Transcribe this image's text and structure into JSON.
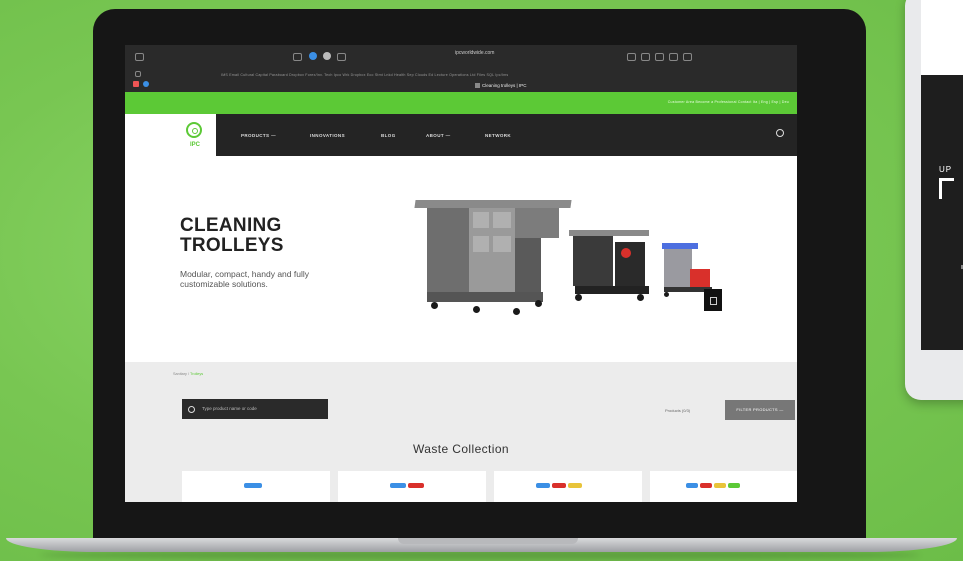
{
  "browser": {
    "url": "ipcworldwide.com",
    "bookmarks": "IMS Email   Cultural Capital   Paraboard   Dropbox   Forex/Inv.   Tech   Ipco   Wrk   Dropbox   Eco   Stmt   Lnkd   Health   Sep   Clouds   Ed   Lecture   Operations   Ltd   Files   SQL   Ipc/Ims",
    "tab_title": "Cleaning trolleys | IPC"
  },
  "site": {
    "top_links": "Customer Area     Become a Professional     Contact     Ita | Eng | Esp | Deu",
    "logo_text": "IPC",
    "nav": [
      "PRODUCTS —",
      "INNOVATIONS",
      "BLOG",
      "ABOUT —",
      "NETWORK"
    ],
    "hero_title": "CLEANING TROLLEYS",
    "hero_sub": "Modular, compact, handy and fully customizable solutions.",
    "breadcrumb_parent": "Sanitary",
    "breadcrumb_current": "Trolleys",
    "search_placeholder": "Type product name or code",
    "compare_label": "Products (0/3)",
    "filter_label": "FILTER PRODUCTS —",
    "section_title": "Waste Collection"
  },
  "colors": {
    "brand_green": "#5cc936",
    "background": "#7ecb5a",
    "navbar": "#242424"
  },
  "icons": [
    "sidebar-icon",
    "home-icon",
    "shield-icon",
    "search-icon",
    "share-icon",
    "plus-icon",
    "tabs-icon"
  ]
}
